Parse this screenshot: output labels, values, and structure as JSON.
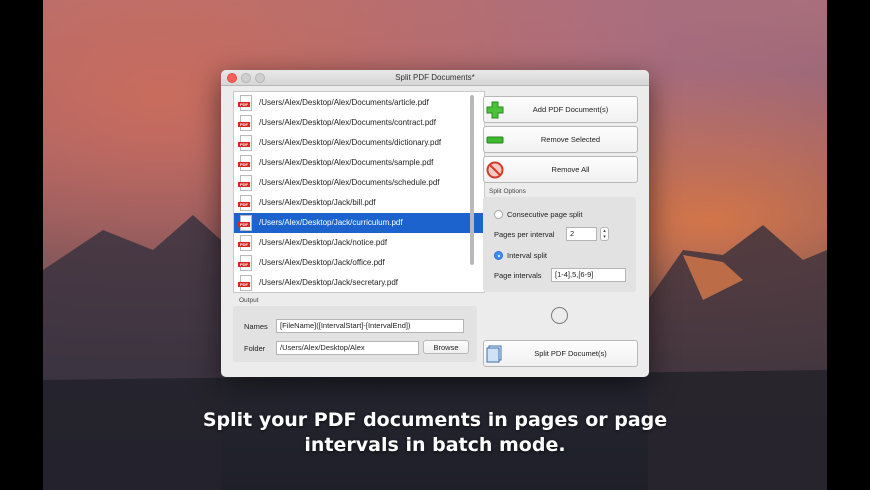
{
  "window": {
    "title": "Split PDF Documents*"
  },
  "files": [
    "/Users/Alex/Desktop/Alex/Documents/article.pdf",
    "/Users/Alex/Desktop/Alex/Documents/contract.pdf",
    "/Users/Alex/Desktop/Alex/Documents/dictionary.pdf",
    "/Users/Alex/Desktop/Alex/Documents/sample.pdf",
    "/Users/Alex/Desktop/Alex/Documents/schedule.pdf",
    "/Users/Alex/Desktop/Jack/bill.pdf",
    "/Users/Alex/Desktop/Jack/curriculum.pdf",
    "/Users/Alex/Desktop/Jack/notice.pdf",
    "/Users/Alex/Desktop/Jack/office.pdf",
    "/Users/Alex/Desktop/Jack/secretary.pdf"
  ],
  "selected_file_index": 6,
  "pdf_badge": "PDF",
  "output": {
    "group_label": "Output",
    "names_label": "Names",
    "names_value": "[FileName]([IntervalStart]-[IntervalEnd])",
    "folder_label": "Folder",
    "folder_value": "/Users/Alex/Desktop/Alex",
    "browse_label": "Browse"
  },
  "buttons": {
    "add": "Add PDF Document(s)",
    "remove_selected": "Remove Selected",
    "remove_all": "Remove All",
    "split": "Split PDF Documet(s)"
  },
  "split_options": {
    "group_label": "Split Options",
    "consecutive_label": "Consecutive page split",
    "pages_per_interval_label": "Pages per interval",
    "pages_per_interval_value": "2",
    "interval_label": "Interval split",
    "page_intervals_label": "Page intervals",
    "page_intervals_value": "[1-4],5,[6-9]",
    "selected_mode": "interval"
  },
  "caption": {
    "line1": "Split your PDF documents in pages or page",
    "line2": "intervals in batch mode."
  },
  "colors": {
    "selection": "#1c63ce",
    "add_icon": "#4cc23a",
    "remove_icon": "#3cba2e",
    "remove_all_icon": "#d23a2a"
  }
}
